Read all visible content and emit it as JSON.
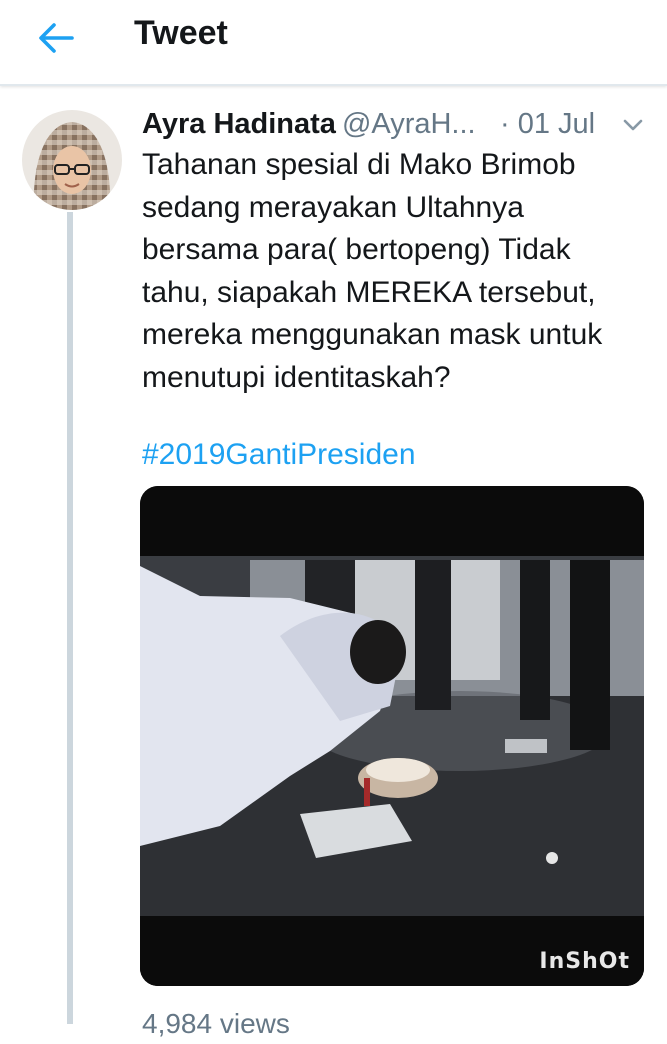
{
  "header": {
    "title": "Tweet"
  },
  "tweet": {
    "author_name": "Ayra Hadinata",
    "author_handle": "@AyraH...",
    "date": "· 01 Jul",
    "text": "Tahanan spesial di Mako Brimob\nsedang  merayakan Ultahnya\nbersama para( bertopeng) Tidak\ntahu, siapakah MEREKA tersebut,\nmereka menggunakan mask untuk\nmenutupi identitaskah?",
    "hashtag": "#2019GantiPresiden",
    "media_watermark": "InShOt",
    "views": "4,984 views"
  },
  "colors": {
    "accent": "#1da1f2",
    "secondary_text": "#657786",
    "divider": "#e1e8ed",
    "thread_line": "#ccd6dd"
  },
  "icons": {
    "back": "arrow-left-icon",
    "menu": "chevron-down-icon"
  }
}
